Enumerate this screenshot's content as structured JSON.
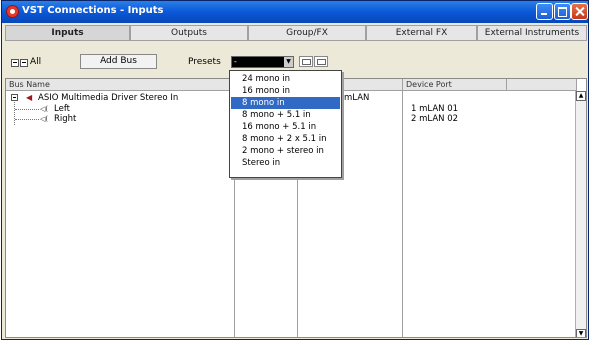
{
  "window": {
    "title": "VST Connections - Inputs"
  },
  "tabs": [
    {
      "label": "Inputs",
      "active": true
    },
    {
      "label": "Outputs"
    },
    {
      "label": "Group/FX"
    },
    {
      "label": "External FX"
    },
    {
      "label": "External Instruments"
    }
  ],
  "toolbar": {
    "all_label": "All",
    "add_bus_label": "Add Bus",
    "presets_label": "Presets",
    "presets_value": "-"
  },
  "columns": [
    "Bus Name",
    "",
    "Device",
    "Device Port"
  ],
  "buses": [
    {
      "name": "ASIO Multimedia Driver Stereo In",
      "device": "mLAN",
      "channels": [
        {
          "name": "Left",
          "port": "1 mLAN 01"
        },
        {
          "name": "Right",
          "port": "2 mLAN 02"
        }
      ]
    }
  ],
  "presets_dropdown": {
    "options": [
      "24 mono in",
      "16 mono in",
      "8 mono in",
      "8 mono + 5.1 in",
      "16 mono + 5.1 in",
      "8 mono + 2 x 5.1 in",
      "2 mono + stereo in",
      "Stereo in"
    ],
    "selected_index": 2
  },
  "colors": {
    "title_bar": "#0a58d8",
    "selection": "#316ac5",
    "close_button": "#c3391a"
  }
}
